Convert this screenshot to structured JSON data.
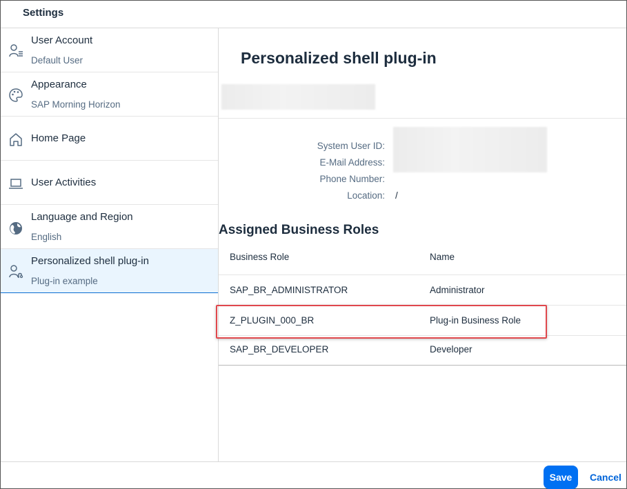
{
  "dialog": {
    "title": "Settings"
  },
  "sidebar": {
    "items": [
      {
        "title": "User Account",
        "subtitle": "Default User",
        "icon": "user-settings-icon"
      },
      {
        "title": "Appearance",
        "subtitle": "SAP Morning Horizon",
        "icon": "palette-icon"
      },
      {
        "title": "Home Page",
        "subtitle": "",
        "icon": "home-icon"
      },
      {
        "title": "User Activities",
        "subtitle": "",
        "icon": "laptop-icon"
      },
      {
        "title": "Language and Region",
        "subtitle": "English",
        "icon": "globe-icon"
      },
      {
        "title": "Personalized shell plug-in",
        "subtitle": "Plug-in example",
        "icon": "user-plugin-icon",
        "selected": true
      }
    ]
  },
  "content": {
    "title": "Personalized shell plug-in",
    "fields": {
      "system_user_id_label": "System User ID:",
      "email_label": "E-Mail Address:",
      "phone_label": "Phone Number:",
      "location_label": "Location:",
      "location_value": "/"
    },
    "roles": {
      "title": "Assigned Business Roles",
      "columns": [
        "Business Role",
        "Name"
      ],
      "rows": [
        {
          "role": "SAP_BR_ADMINISTRATOR",
          "name": "Administrator"
        },
        {
          "role": "Z_PLUGIN_000_BR",
          "name": "Plug-in Business Role",
          "highlighted": true
        },
        {
          "role": "SAP_BR_DEVELOPER",
          "name": "Developer"
        }
      ]
    }
  },
  "footer": {
    "save_label": "Save",
    "cancel_label": "Cancel"
  },
  "colors": {
    "accent": "#0070f2",
    "highlight": "#e0474c",
    "selected_bg": "#eaf5fe"
  }
}
